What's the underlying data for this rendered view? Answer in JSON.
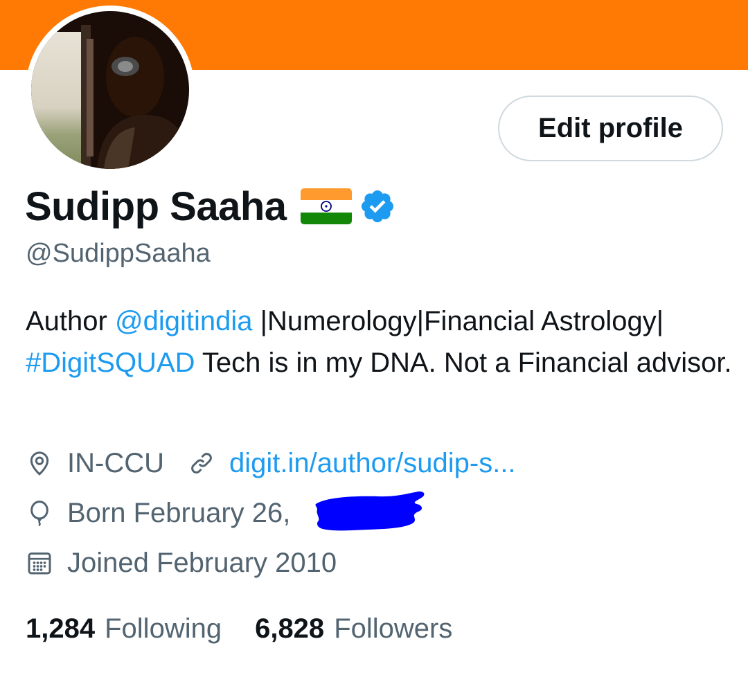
{
  "banner": {
    "color": "#ff7a05"
  },
  "profile": {
    "display_name": "Sudipp Saaha",
    "flag_icon": "india-flag-icon",
    "verified_icon": "verified-badge-icon",
    "handle": "@SudippSaaha",
    "edit_button_label": "Edit profile"
  },
  "bio": {
    "part1": "Author ",
    "mention": "@digitindia",
    "part2": " |Numerology|Financial Astrology| ",
    "hashtag": "#DigitSQUAD",
    "part3": " Tech is in my DNA.  Not a Financial advisor."
  },
  "meta": {
    "location_icon": "location-pin-icon",
    "location": "IN-CCU",
    "link_icon": "link-icon",
    "website": "digit.in/author/sudip-s...",
    "birthday_icon": "balloon-icon",
    "birthday": "Born February 26,",
    "joined_icon": "calendar-icon",
    "joined": "Joined February 2010"
  },
  "stats": {
    "following_count": "1,284",
    "following_label": "Following",
    "followers_count": "6,828",
    "followers_label": "Followers"
  },
  "colors": {
    "accent": "#1d9bf0",
    "secondary_text": "#536471",
    "primary_text": "#0f1419",
    "redaction": "#0000ff"
  }
}
